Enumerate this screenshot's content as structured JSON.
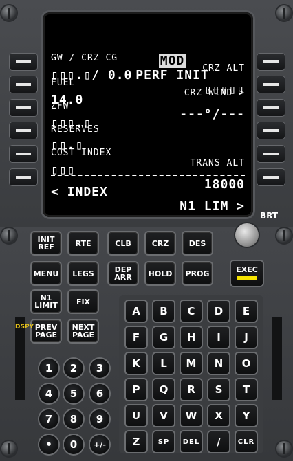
{
  "display": {
    "mod_tag": "MOD",
    "title": "PERF INIT",
    "left_labels": [
      "GW / CRZ CG",
      "FUEL",
      "ZFW",
      "RESERVES",
      "COST INDEX",
      ""
    ],
    "left_values": [
      "▯▯▯.▯/ 0.0",
      "14.0",
      "▯▯▯.▯",
      "▯▯.▯",
      "▯▯▯",
      "< INDEX"
    ],
    "right_labels": [
      "CRZ ALT",
      "CRZ WIND >",
      "",
      "",
      "TRANS ALT",
      ""
    ],
    "right_values": [
      "▯▯▯▯▯",
      "---°/---",
      "",
      "",
      "18000",
      "N1 LIM >"
    ]
  },
  "brightness_label": "BRT",
  "function_keys": {
    "row1": [
      "INIT\nREF",
      "RTE",
      "CLB",
      "CRZ",
      "DES"
    ],
    "row2": [
      "MENU",
      "LEGS",
      "DEP\nARR",
      "HOLD",
      "PROG"
    ],
    "row3": [
      "N1\nLIMIT",
      "FIX"
    ],
    "row4": [
      "PREV\nPAGE",
      "NEXT\nPAGE"
    ]
  },
  "exec_label": "EXEC",
  "alpha_keys": [
    [
      "A",
      "B",
      "C",
      "D",
      "E"
    ],
    [
      "F",
      "G",
      "H",
      "I",
      "J"
    ],
    [
      "K",
      "L",
      "M",
      "N",
      "O"
    ],
    [
      "P",
      "Q",
      "R",
      "S",
      "T"
    ],
    [
      "U",
      "V",
      "W",
      "X",
      "Y"
    ],
    [
      "Z",
      "SP",
      "DEL",
      "/",
      "CLR"
    ]
  ],
  "num_keys": [
    [
      "1",
      "2",
      "3"
    ],
    [
      "4",
      "5",
      "6"
    ],
    [
      "7",
      "8",
      "9"
    ],
    [
      "•",
      "0",
      "+/-"
    ]
  ],
  "dspy_label": "DSPY",
  "colors": {
    "bezel": "#3b3d40",
    "screen_bg": "#000000",
    "text": "#ffffff",
    "exec_light": "#f5e300",
    "dspy": "#e6c21a"
  }
}
